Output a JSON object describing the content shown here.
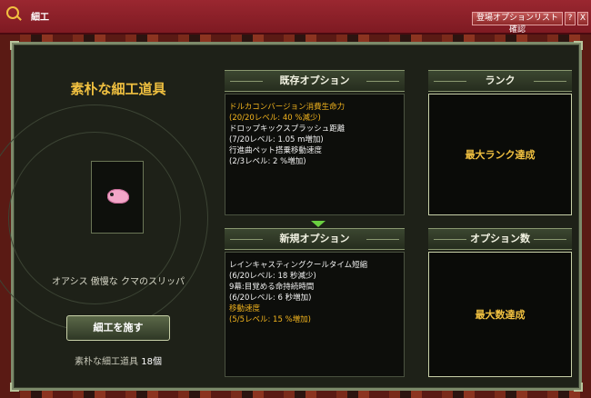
{
  "window": {
    "title": "細工",
    "confirm_button": "登場オプションリスト確認",
    "help_button": "?",
    "close_button": "X"
  },
  "item": {
    "title": "素朴な細工道具",
    "name": "オアシス 傲慢な クマのスリッパ",
    "icon": "pink-slipper-icon"
  },
  "craft": {
    "button_label": "細工を施す",
    "tool_label": "素朴な細工道具",
    "tool_count": "18",
    "tool_unit": "個"
  },
  "existing_options": {
    "header": "既存オプション",
    "lines": [
      {
        "text": "ドルカコンバージョン消費生命力",
        "color": "gold"
      },
      {
        "text": "(20/20レベル: 40 %減少)",
        "color": "gold"
      },
      {
        "text": "ドロップキックスプラッシュ距離",
        "color": "white"
      },
      {
        "text": "(7/20レベル: 1.05 m増加)",
        "color": "white"
      },
      {
        "text": "行進曲ペット搭乗移動速度",
        "color": "white"
      },
      {
        "text": "(2/3レベル: 2 %増加)",
        "color": "white"
      }
    ]
  },
  "new_options": {
    "header": "新規オプション",
    "lines": [
      {
        "text": "レインキャスティングクールタイム短縮",
        "color": "white"
      },
      {
        "text": "(6/20レベル: 18 秒減少)",
        "color": "white"
      },
      {
        "text": "9幕:目覚める命持続時間",
        "color": "white"
      },
      {
        "text": "(6/20レベル: 6 秒増加)",
        "color": "white"
      },
      {
        "text": "移動速度",
        "color": "gold"
      },
      {
        "text": "(5/5レベル: 15 %増加)",
        "color": "gold"
      }
    ]
  },
  "rank": {
    "header": "ランク",
    "status": "最大ランク達成"
  },
  "option_count": {
    "header": "オプション数",
    "status": "最大数達成"
  },
  "colors": {
    "gold": "#f2b41e",
    "title_bar": "#8e2028",
    "panel_bg": "#1e2118",
    "border": "#c8d0a8"
  }
}
